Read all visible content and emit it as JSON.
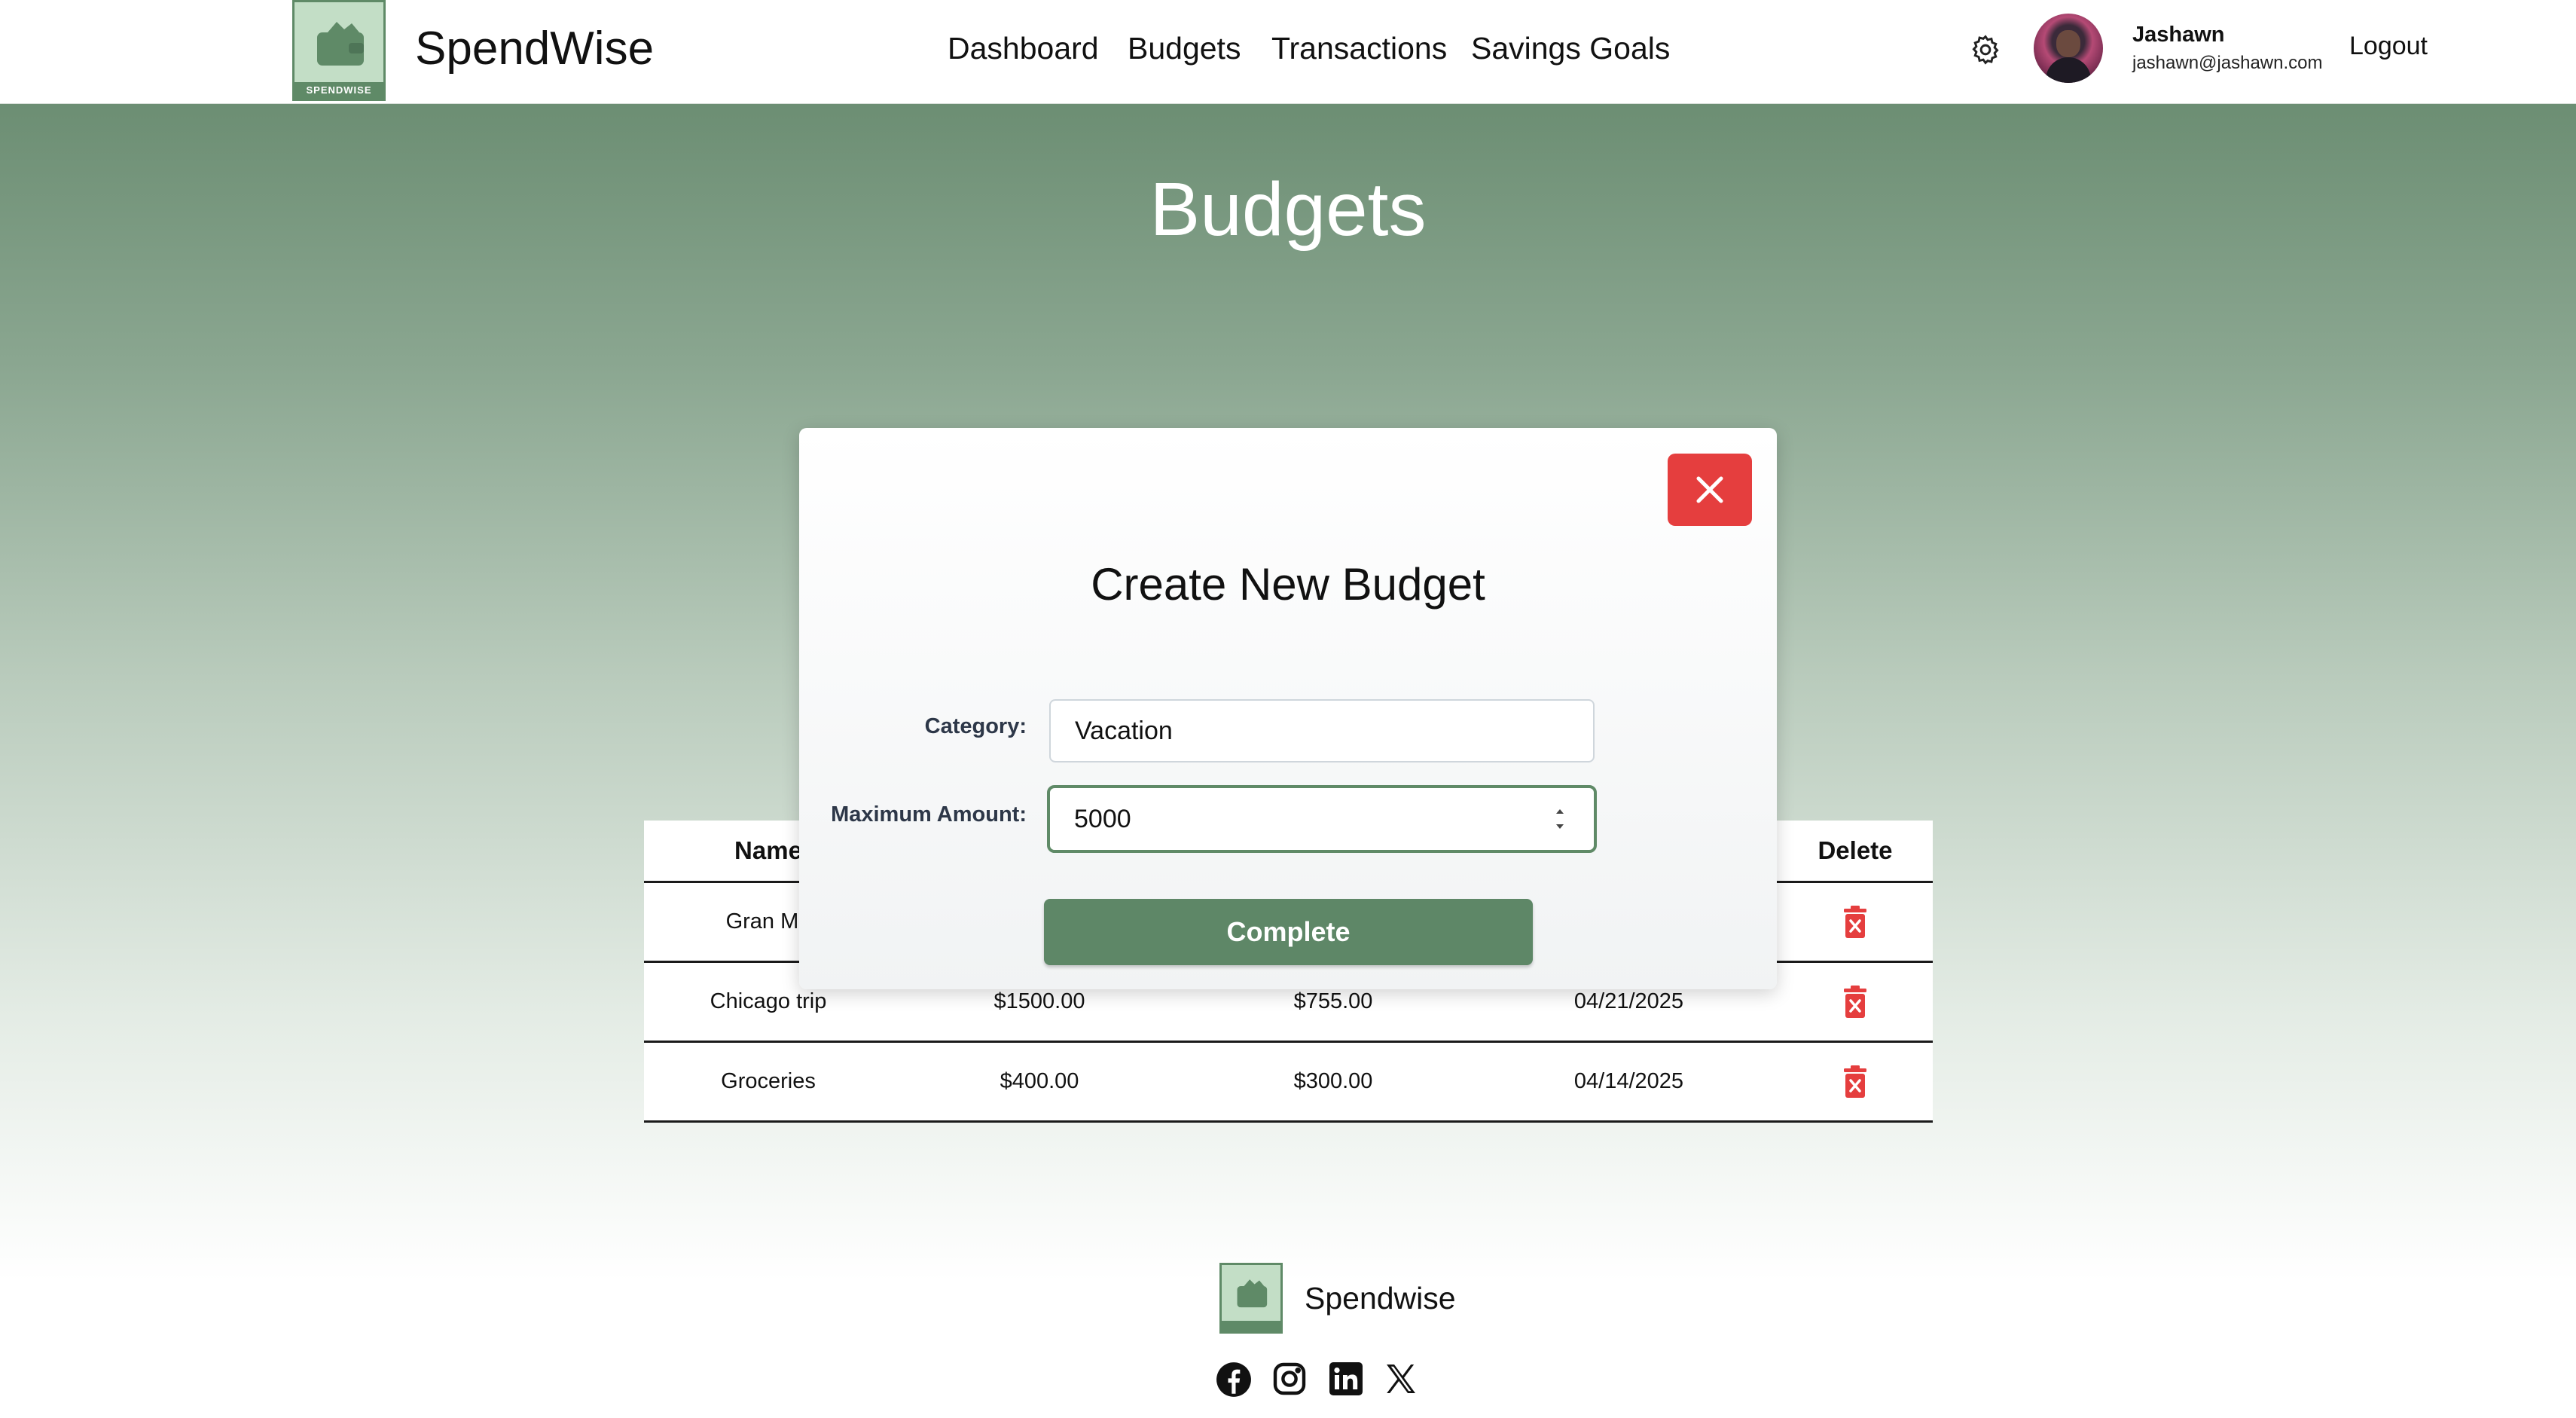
{
  "header": {
    "logo_text": "SPENDWISE",
    "brand": "SpendWise",
    "nav": [
      "Dashboard",
      "Budgets",
      "Transactions",
      "Savings Goals"
    ],
    "user_name": "Jashawn",
    "user_email": "jashawn@jashawn.com",
    "logout": "Logout"
  },
  "page": {
    "title": "Budgets"
  },
  "table": {
    "headers": [
      "Name",
      "",
      "",
      "",
      "Delete"
    ],
    "rows": [
      [
        "Gran Ma",
        "",
        "",
        ""
      ],
      [
        "Chicago trip",
        "$1500.00",
        "$755.00",
        "04/21/2025"
      ],
      [
        "Groceries",
        "$400.00",
        "$300.00",
        "04/14/2025"
      ]
    ]
  },
  "modal": {
    "title": "Create New Budget",
    "category_label": "Category:",
    "category_value": "Vacation",
    "amount_label": "Maximum Amount:",
    "amount_value": "5000",
    "submit": "Complete"
  },
  "footer": {
    "brand": "Spendwise"
  },
  "colors": {
    "brand_green": "#5e8767",
    "danger_red": "#e53e3e",
    "logo_bg": "#c3dec6"
  },
  "icons": [
    "wallet-icon",
    "gear-icon",
    "close-icon",
    "trash-icon",
    "facebook-icon",
    "instagram-icon",
    "linkedin-icon",
    "x-icon"
  ]
}
